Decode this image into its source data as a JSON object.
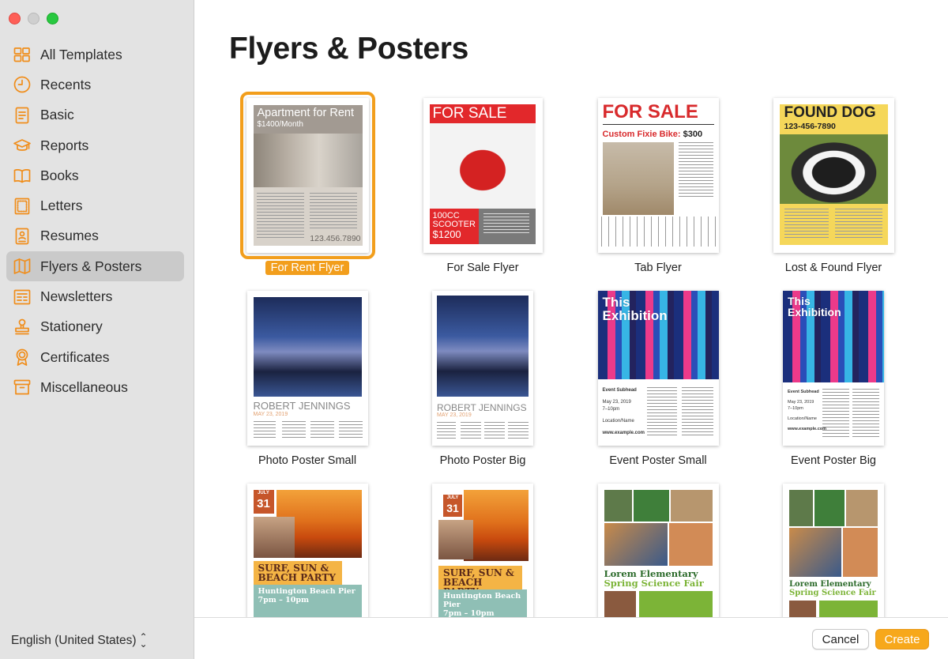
{
  "sidebar": {
    "items": [
      {
        "label": "All Templates",
        "icon": "grid-icon",
        "active": false
      },
      {
        "label": "Recents",
        "icon": "clock-icon",
        "active": false
      },
      {
        "label": "Basic",
        "icon": "document-icon",
        "active": false
      },
      {
        "label": "Reports",
        "icon": "graduation-cap-icon",
        "active": false
      },
      {
        "label": "Books",
        "icon": "book-icon",
        "active": false
      },
      {
        "label": "Letters",
        "icon": "letter-icon",
        "active": false
      },
      {
        "label": "Resumes",
        "icon": "resume-icon",
        "active": false
      },
      {
        "label": "Flyers & Posters",
        "icon": "map-icon",
        "active": true
      },
      {
        "label": "Newsletters",
        "icon": "newsletter-icon",
        "active": false
      },
      {
        "label": "Stationery",
        "icon": "stamp-icon",
        "active": false
      },
      {
        "label": "Certificates",
        "icon": "ribbon-icon",
        "active": false
      },
      {
        "label": "Miscellaneous",
        "icon": "archive-box-icon",
        "active": false
      }
    ],
    "language": "English (United States)"
  },
  "main": {
    "title": "Flyers & Posters",
    "templates": [
      {
        "label": "For Rent Flyer",
        "selected": true
      },
      {
        "label": "For Sale Flyer",
        "selected": false
      },
      {
        "label": "Tab Flyer",
        "selected": false
      },
      {
        "label": "Lost & Found Flyer",
        "selected": false
      },
      {
        "label": "Photo Poster Small",
        "selected": false
      },
      {
        "label": "Photo Poster Big",
        "selected": false
      },
      {
        "label": "Event Poster Small",
        "selected": false
      },
      {
        "label": "Event Poster Big",
        "selected": false
      },
      {
        "label": "",
        "selected": false
      },
      {
        "label": "",
        "selected": false
      },
      {
        "label": "",
        "selected": false
      },
      {
        "label": "",
        "selected": false
      }
    ]
  },
  "thumbs": {
    "rent": {
      "heading": "Apartment for Rent",
      "price": "$1400/Month",
      "phone": "123.456.7890"
    },
    "sale": {
      "heading": "FOR SALE",
      "line1": "100CC",
      "line2": "SCOOTER",
      "price": "$1200"
    },
    "tab": {
      "heading": "FOR SALE",
      "subtitle": "Custom Fixie Bike:",
      "price": "$300"
    },
    "dog": {
      "heading": "FOUND DOG",
      "phone": "123-456-7890"
    },
    "photo_small": {
      "name": "ROBERT JENNINGS",
      "date": "MAY 23, 2019"
    },
    "photo_big": {
      "name": "ROBERT JENNINGS",
      "date": "MAY 23, 2019"
    },
    "event_small": {
      "heading": "This Exhibition",
      "subhead": "Event Subhead",
      "date": "May 23, 2019",
      "time": "7–10pm",
      "location": "Location/Name",
      "url": "www.example.com"
    },
    "event_big": {
      "heading": "This Exhibition",
      "subhead": "Event Subhead",
      "date": "May 23, 2019",
      "time": "7–10pm",
      "location": "Location/Name",
      "url": "www.example.com"
    },
    "beach1": {
      "month": "JULY",
      "day": "31",
      "headline1": "SURF, SUN &",
      "headline2": "BEACH PARTY",
      "place": "Huntington Beach Pier",
      "time": "7pm – 10pm"
    },
    "beach2": {
      "month": "JULY",
      "day": "31",
      "headline1": "SURF, SUN &",
      "headline2": "BEACH PARTY",
      "place": "Huntington Beach Pier",
      "time": "7pm – 10pm"
    },
    "science1": {
      "line1": "Lorem Elementary",
      "line2": "Spring Science Fair"
    },
    "science2": {
      "line1": "Lorem Elementary",
      "line2": "Spring Science Fair"
    }
  },
  "footer": {
    "cancel": "Cancel",
    "create": "Create"
  },
  "colors": {
    "accent": "#f29e1c",
    "icon": "#f08d1a",
    "create_button": "#f7a81b",
    "sidebar_bg": "#e3e3e3"
  }
}
